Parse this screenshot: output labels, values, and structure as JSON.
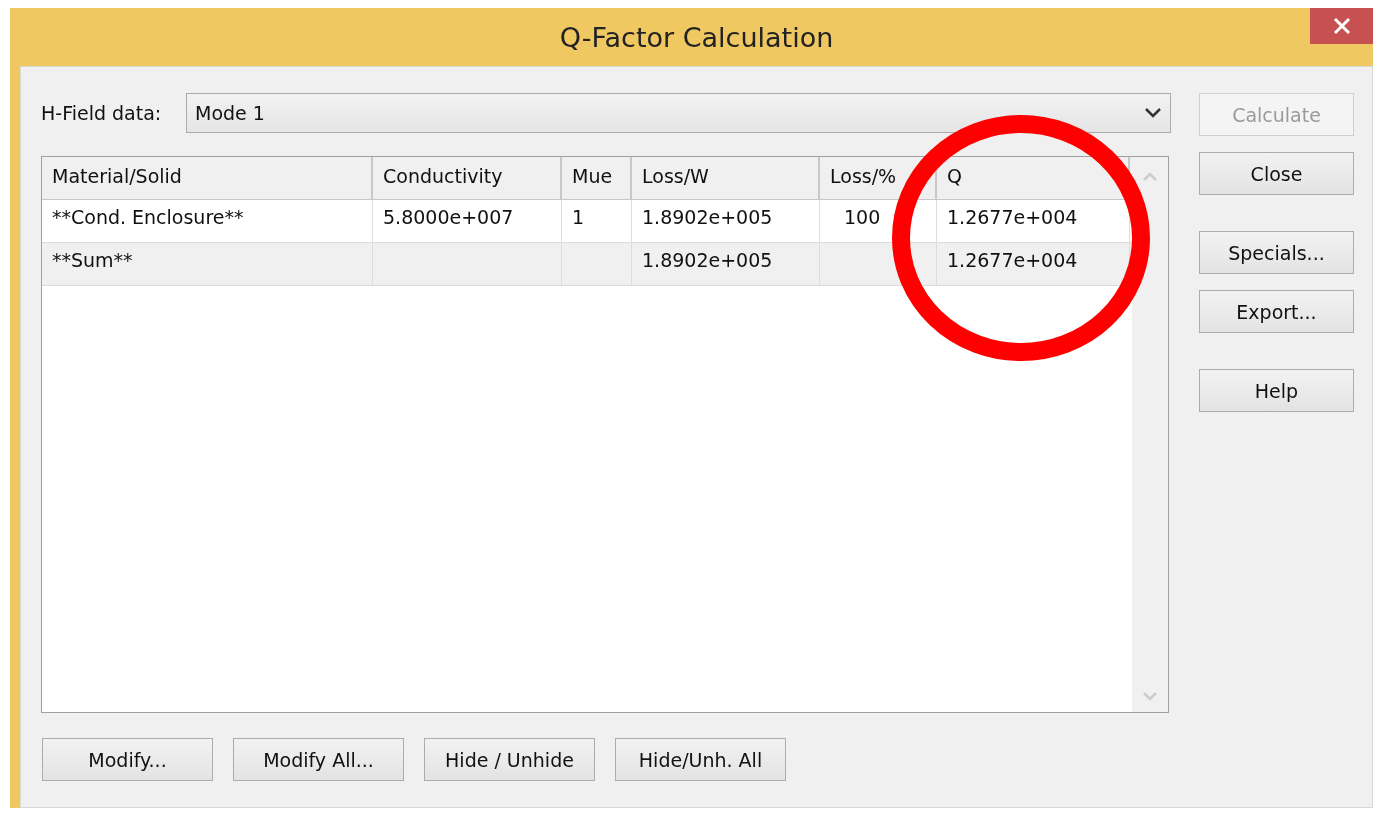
{
  "window": {
    "title": "Q-Factor Calculation"
  },
  "source": {
    "label": "H-Field data:",
    "value": "Mode 1"
  },
  "table": {
    "columns": [
      "Material/Solid",
      "Conductivity",
      "Mue",
      "Loss/W",
      "Loss/%",
      "Q"
    ],
    "rows": [
      {
        "kind": "item",
        "cells": [
          "**Cond. Enclosure**",
          "5.8000e+007",
          "1",
          "1.8902e+005",
          "100",
          "1.2677e+004"
        ]
      },
      {
        "kind": "sum",
        "cells": [
          "**Sum**",
          "",
          "",
          "1.8902e+005",
          "",
          "1.2677e+004"
        ]
      }
    ]
  },
  "side_buttons": [
    {
      "label": "Calculate",
      "disabled": true
    },
    {
      "label": "Close",
      "disabled": false
    },
    {
      "label": "Specials...",
      "disabled": false
    },
    {
      "label": "Export...",
      "disabled": false
    },
    {
      "label": "Help",
      "disabled": false
    }
  ],
  "bottom_buttons": [
    {
      "label": "Modify...",
      "disabled": false
    },
    {
      "label": "Modify All...",
      "disabled": false
    },
    {
      "label": "Hide / Unhide",
      "disabled": false
    },
    {
      "label": "Hide/Unh. All",
      "disabled": false
    }
  ],
  "annotations": [
    {
      "kind": "circle",
      "color": "#ff0000"
    }
  ]
}
